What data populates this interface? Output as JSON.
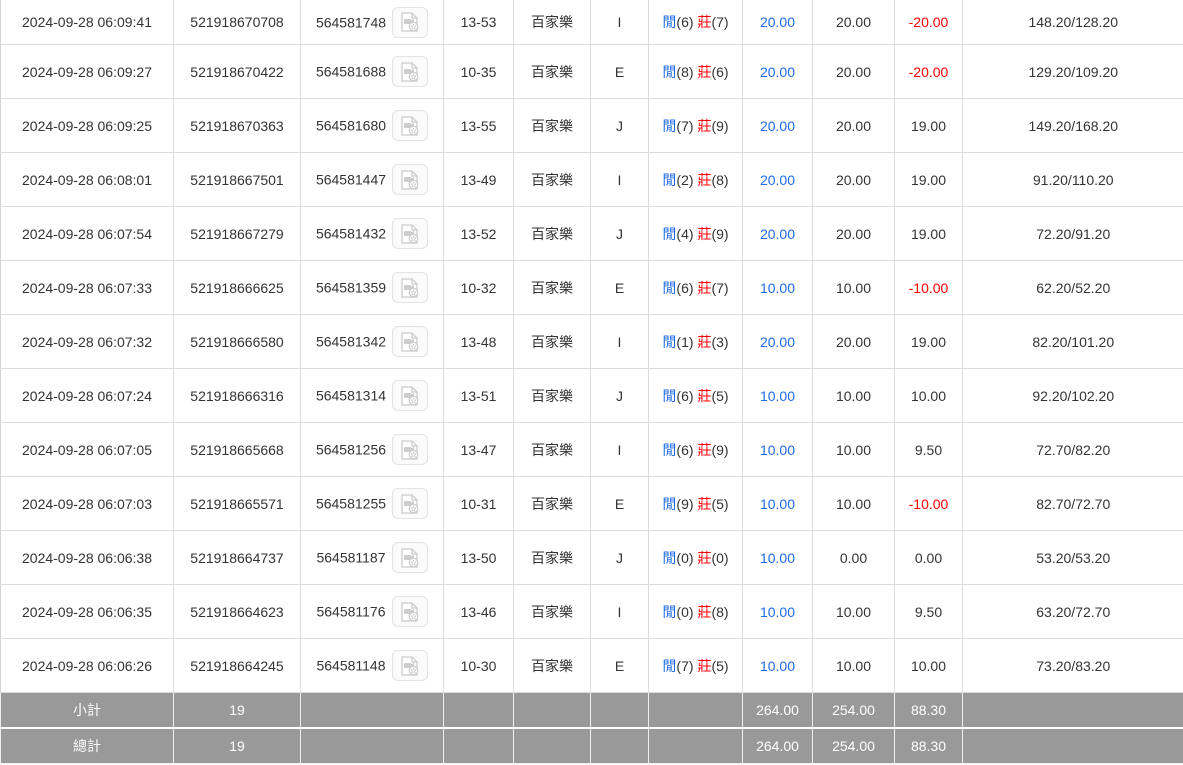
{
  "colors": {
    "link_blue": "#1f6ce8",
    "loss_red": "#ff0000",
    "text": "#333333",
    "summary_bg": "#999999",
    "grid_border": "#dcdcdc"
  },
  "result_labels": {
    "player": "閒",
    "banker": "莊"
  },
  "icons": {
    "video_replay": "video-replay-icon"
  },
  "table": {
    "rows": [
      {
        "time": "2024-09-28 06:09:41",
        "bet_id": "521918670708",
        "round_id": "564581748",
        "table_round": "13-53",
        "game": "百家樂",
        "table_code": "I",
        "player_score": "(6)",
        "banker_score": "(7)",
        "bet": "20.00",
        "valid": "20.00",
        "win_loss": "-20.00",
        "balance": "148.20/128.20"
      },
      {
        "time": "2024-09-28 06:09:27",
        "bet_id": "521918670422",
        "round_id": "564581688",
        "table_round": "10-35",
        "game": "百家樂",
        "table_code": "E",
        "player_score": "(8)",
        "banker_score": "(6)",
        "bet": "20.00",
        "valid": "20.00",
        "win_loss": "-20.00",
        "balance": "129.20/109.20"
      },
      {
        "time": "2024-09-28 06:09:25",
        "bet_id": "521918670363",
        "round_id": "564581680",
        "table_round": "13-55",
        "game": "百家樂",
        "table_code": "J",
        "player_score": "(7)",
        "banker_score": "(9)",
        "bet": "20.00",
        "valid": "20.00",
        "win_loss": "19.00",
        "balance": "149.20/168.20"
      },
      {
        "time": "2024-09-28 06:08:01",
        "bet_id": "521918667501",
        "round_id": "564581447",
        "table_round": "13-49",
        "game": "百家樂",
        "table_code": "I",
        "player_score": "(2)",
        "banker_score": "(8)",
        "bet": "20.00",
        "valid": "20.00",
        "win_loss": "19.00",
        "balance": "91.20/110.20"
      },
      {
        "time": "2024-09-28 06:07:54",
        "bet_id": "521918667279",
        "round_id": "564581432",
        "table_round": "13-52",
        "game": "百家樂",
        "table_code": "J",
        "player_score": "(4)",
        "banker_score": "(9)",
        "bet": "20.00",
        "valid": "20.00",
        "win_loss": "19.00",
        "balance": "72.20/91.20"
      },
      {
        "time": "2024-09-28 06:07:33",
        "bet_id": "521918666625",
        "round_id": "564581359",
        "table_round": "10-32",
        "game": "百家樂",
        "table_code": "E",
        "player_score": "(6)",
        "banker_score": "(7)",
        "bet": "10.00",
        "valid": "10.00",
        "win_loss": "-10.00",
        "balance": "62.20/52.20"
      },
      {
        "time": "2024-09-28 06:07:32",
        "bet_id": "521918666580",
        "round_id": "564581342",
        "table_round": "13-48",
        "game": "百家樂",
        "table_code": "I",
        "player_score": "(1)",
        "banker_score": "(3)",
        "bet": "20.00",
        "valid": "20.00",
        "win_loss": "19.00",
        "balance": "82.20/101.20"
      },
      {
        "time": "2024-09-28 06:07:24",
        "bet_id": "521918666316",
        "round_id": "564581314",
        "table_round": "13-51",
        "game": "百家樂",
        "table_code": "J",
        "player_score": "(6)",
        "banker_score": "(5)",
        "bet": "10.00",
        "valid": "10.00",
        "win_loss": "10.00",
        "balance": "92.20/102.20"
      },
      {
        "time": "2024-09-28 06:07:05",
        "bet_id": "521918665668",
        "round_id": "564581256",
        "table_round": "13-47",
        "game": "百家樂",
        "table_code": "I",
        "player_score": "(6)",
        "banker_score": "(9)",
        "bet": "10.00",
        "valid": "10.00",
        "win_loss": "9.50",
        "balance": "72.70/82.20"
      },
      {
        "time": "2024-09-28 06:07:03",
        "bet_id": "521918665571",
        "round_id": "564581255",
        "table_round": "10-31",
        "game": "百家樂",
        "table_code": "E",
        "player_score": "(9)",
        "banker_score": "(5)",
        "bet": "10.00",
        "valid": "10.00",
        "win_loss": "-10.00",
        "balance": "82.70/72.70"
      },
      {
        "time": "2024-09-28 06:06:38",
        "bet_id": "521918664737",
        "round_id": "564581187",
        "table_round": "13-50",
        "game": "百家樂",
        "table_code": "J",
        "player_score": "(0)",
        "banker_score": "(0)",
        "bet": "10.00",
        "valid": "0.00",
        "win_loss": "0.00",
        "balance": "53.20/53.20"
      },
      {
        "time": "2024-09-28 06:06:35",
        "bet_id": "521918664623",
        "round_id": "564581176",
        "table_round": "13-46",
        "game": "百家樂",
        "table_code": "I",
        "player_score": "(0)",
        "banker_score": "(8)",
        "bet": "10.00",
        "valid": "10.00",
        "win_loss": "9.50",
        "balance": "63.20/72.70"
      },
      {
        "time": "2024-09-28 06:06:26",
        "bet_id": "521918664245",
        "round_id": "564581148",
        "table_round": "10-30",
        "game": "百家樂",
        "table_code": "E",
        "player_score": "(7)",
        "banker_score": "(5)",
        "bet": "10.00",
        "valid": "10.00",
        "win_loss": "10.00",
        "balance": "73.20/83.20"
      }
    ],
    "subtotal": {
      "label": "小計",
      "count": "19",
      "bet": "264.00",
      "valid": "254.00",
      "win_loss": "88.30"
    },
    "total": {
      "label": "總計",
      "count": "19",
      "bet": "264.00",
      "valid": "254.00",
      "win_loss": "88.30"
    }
  }
}
